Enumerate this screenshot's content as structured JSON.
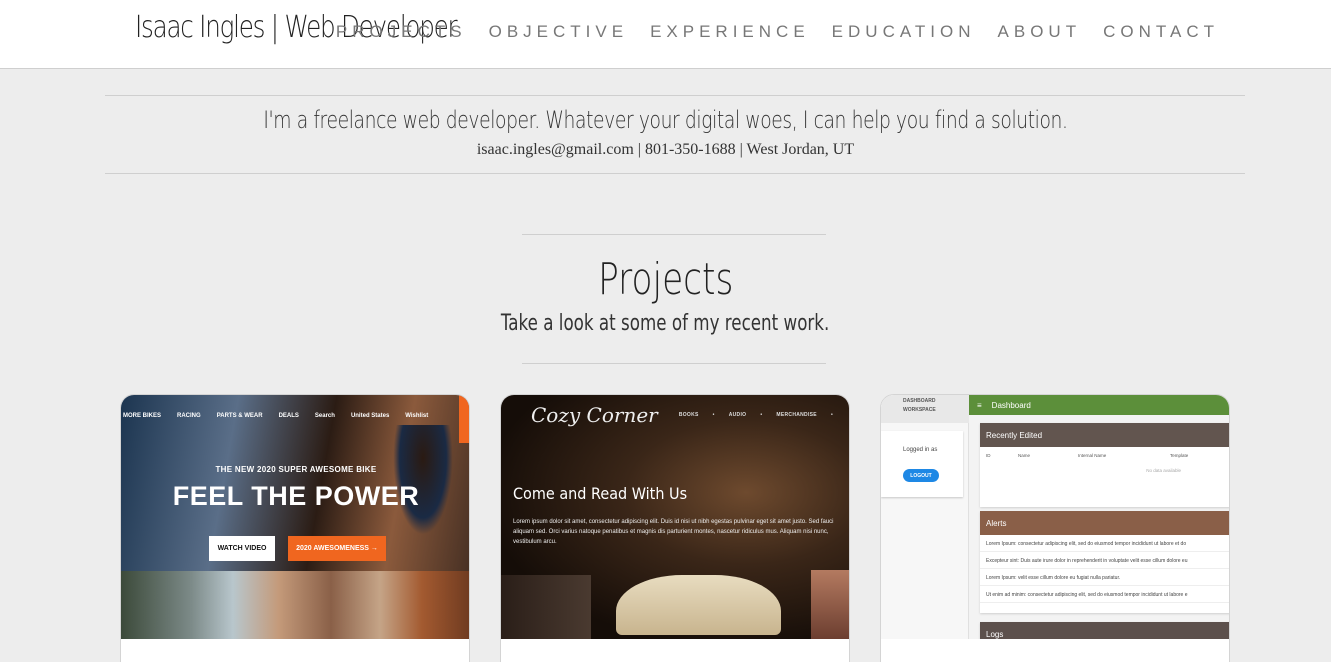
{
  "header": {
    "brand": "Isaac Ingles | Web Developer",
    "nav": [
      "PROJECTS",
      "OBJECTIVE",
      "EXPERIENCE",
      "EDUCATION",
      "ABOUT",
      "CONTACT"
    ]
  },
  "intro": {
    "tagline": "I'm a freelance web developer. Whatever your digital woes, I can help you find a solution.",
    "contact": "isaac.ingles@gmail.com | 801-350-1688 | West Jordan, UT"
  },
  "projects": {
    "title": "Projects",
    "subtitle": "Take a look at some of my recent work."
  },
  "cards": {
    "bike": {
      "nav": [
        "MORE BIKES",
        "RACING",
        "PARTS & WEAR",
        "DEALS",
        "Search",
        "United States",
        "Wishlist"
      ],
      "kicker": "THE NEW 2020 SUPER AWESOME BIKE",
      "headline": "FEEL THE POWER",
      "btn_watch": "WATCH VIDEO",
      "btn_awesome": "2020 AWESOMENESS →"
    },
    "cozy": {
      "logo": "Cozy Corner",
      "nav": [
        "BOOKS",
        "AUDIO",
        "MERCHANDISE"
      ],
      "heading": "Come and Read With Us",
      "lorem": "Lorem ipsum dolor sit amet, consectetur adipiscing elit. Duis id nisi ut nibh egestas pulvinar eget sit amet justo. Sed fauci aliquam sed. Orci varius natoque penatibus et magnis dis parturient montes, nascetur ridiculus mus. Aliquam nisi nunc, vestibulum arcu."
    },
    "dash": {
      "side_items": [
        "DASHBOARD",
        "WORKSPACE"
      ],
      "logged_in": "Logged in as",
      "logout": "LOGOUT",
      "appbar": "Dashboard",
      "recently_edited": "Recently Edited",
      "columns": [
        "ID",
        "Name",
        "Internal Name",
        "Template"
      ],
      "no_data": "No data available",
      "alerts_title": "Alerts",
      "alerts": [
        "Lorem Ipsum: consectetur adipiscing elit, sed do eiusmod tempor incididunt ut labore et do",
        "Excepteur sint: Duis aute irure dolor in reprehenderit in voluptate velit esse cillum dolore eu",
        "Lorem Ipsum: velit esse cillum dolore eu fugiat nulla pariatur.",
        "Ut enim ad minim: consectetur adipiscing elit, sed do eiusmod tempor incididunt ut labore e"
      ],
      "logs_title": "Logs"
    }
  },
  "colors": {
    "page_bg": "#ededed",
    "nav_text": "#777777",
    "bike_accent": "#f0661f",
    "dash_green": "#5c8f3a"
  }
}
